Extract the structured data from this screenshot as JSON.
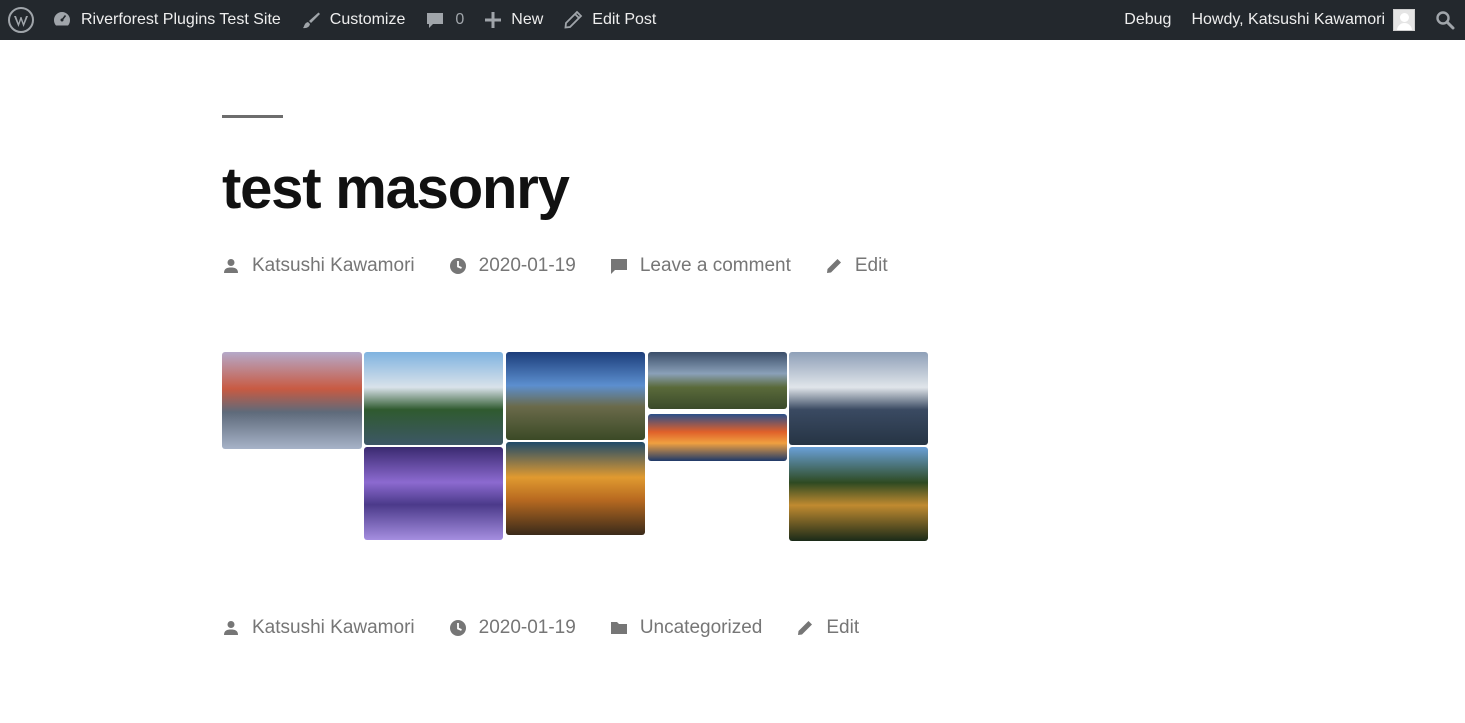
{
  "adminbar": {
    "site_name": "Riverforest Plugins Test Site",
    "customize": "Customize",
    "comments_count": "0",
    "new": "New",
    "edit_post": "Edit Post",
    "debug": "Debug",
    "howdy": "Howdy, Katsushi Kawamori"
  },
  "post": {
    "title": "test masonry",
    "meta_top": {
      "author": "Katsushi Kawamori",
      "date": "2020-01-19",
      "comment": "Leave a comment",
      "edit": "Edit"
    },
    "meta_bottom": {
      "author": "Katsushi Kawamori",
      "date": "2020-01-19",
      "category": "Uncategorized",
      "edit": "Edit"
    }
  },
  "gallery": {
    "images": [
      {
        "name": "valley-sunset-lake",
        "colors": [
          "#b5a9c9",
          "#c85a42",
          "#5e6a7a",
          "#a7b3c8"
        ]
      },
      {
        "name": "forest-river-mountains",
        "colors": [
          "#7fb3e0",
          "#d9e2ea",
          "#2f5a2f",
          "#3d5766"
        ]
      },
      {
        "name": "purple-mountain-valley",
        "colors": [
          "#3a2a70",
          "#8c6ad0",
          "#4b3a8a",
          "#a58ee0"
        ]
      },
      {
        "name": "blue-sky-rocky-peak",
        "colors": [
          "#1c3d7a",
          "#5c8fcf",
          "#6a6a4a",
          "#3b4a26"
        ]
      },
      {
        "name": "golden-sunrise-ridges",
        "colors": [
          "#1f4b6a",
          "#e09a30",
          "#b86a20",
          "#3a2a1a"
        ]
      },
      {
        "name": "green-mountain-pass",
        "colors": [
          "#3b4e6a",
          "#8aa0b8",
          "#5a6a3a",
          "#3a4a2a"
        ]
      },
      {
        "name": "red-sky-sunset-range",
        "colors": [
          "#2a4f8a",
          "#e0602a",
          "#f0a040",
          "#1f3a6a"
        ]
      },
      {
        "name": "mount-fuji-clouds",
        "colors": [
          "#8fa0b8",
          "#e0e5ea",
          "#3a4a62",
          "#263444"
        ]
      },
      {
        "name": "autumn-forest-cliffs",
        "colors": [
          "#6aa0d8",
          "#2e4a22",
          "#c08a30",
          "#1a2a18"
        ]
      }
    ]
  }
}
